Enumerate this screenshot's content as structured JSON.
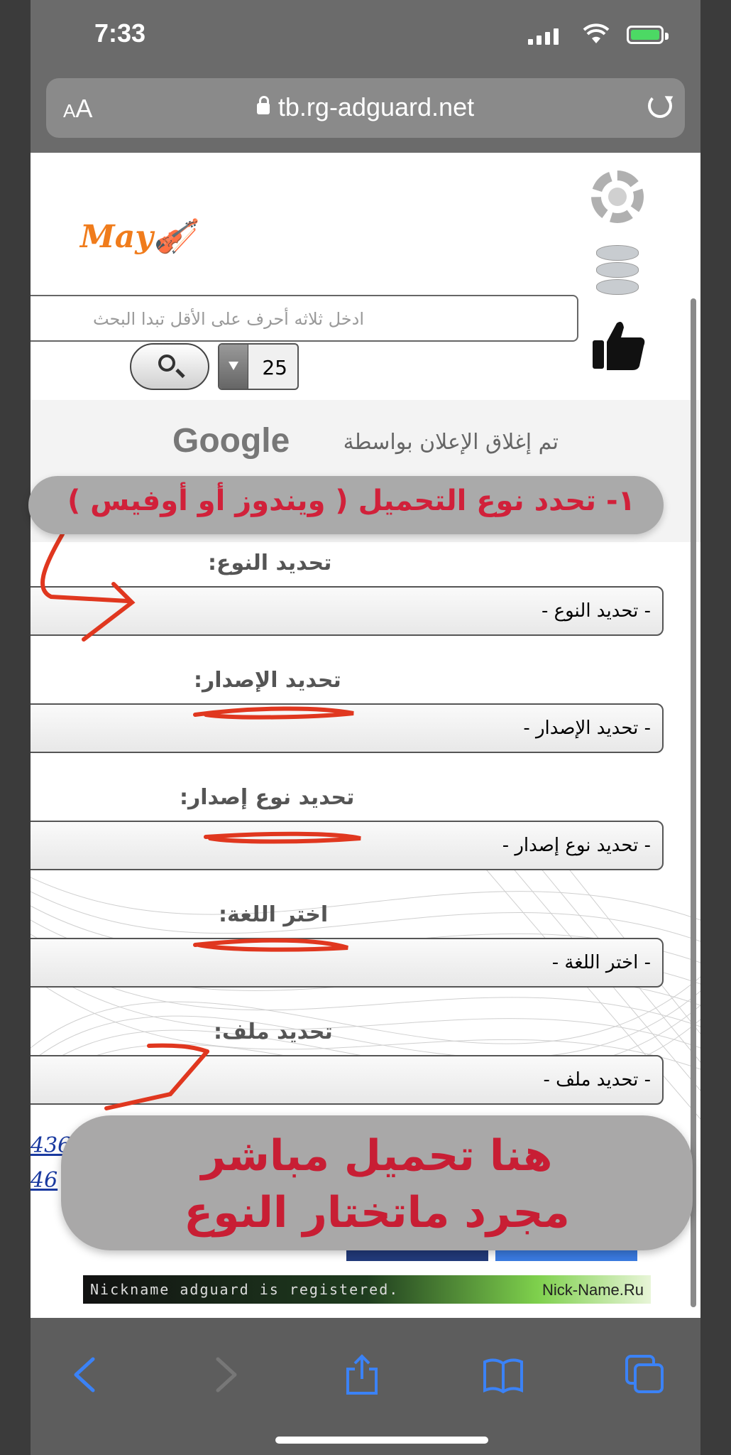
{
  "status": {
    "time": "7:33"
  },
  "browser": {
    "aa_small": "A",
    "aa_big": "A",
    "url": "tb.rg-adguard.net"
  },
  "header": {
    "logo_text": "May"
  },
  "search": {
    "placeholder": "ادخل ثلاثه أحرف على الأقل تبدا البحث",
    "page_size": "25"
  },
  "ad": {
    "closed_text": "تم إغلاق الإعلان بواسطة",
    "google": "Google"
  },
  "annotations": {
    "top": "١- تحدد نوع التحميل ( ويندوز أو أوفيس )",
    "bottom_line1": "هنا تحميل مباشر",
    "bottom_line2": "مجرد ماتختار النوع"
  },
  "form": {
    "type_label": "تحديد النوع:",
    "type_value": "- تحديد النوع -",
    "version_label": "تحديد الإصدار:",
    "version_value": "- تحديد الإصدار -",
    "edition_label": "تحديد نوع إصدار:",
    "edition_value": "- تحديد نوع إصدار -",
    "lang_label": "اختر اللغة:",
    "lang_value": "- اختر اللغة -",
    "file_label": "تحديد ملف:",
    "file_value": "- تحديد ملف -"
  },
  "footer": {
    "link1": "436",
    "link2": "46",
    "copyright": "©",
    "nick_text": "Nickname adguard is registered.",
    "nick_site": "Nick-Name.Ru"
  },
  "colors": {
    "annotation_red": "#d1213a",
    "accent_blue": "#4b8ff0",
    "toolbar_blue": "#3b82f6"
  }
}
